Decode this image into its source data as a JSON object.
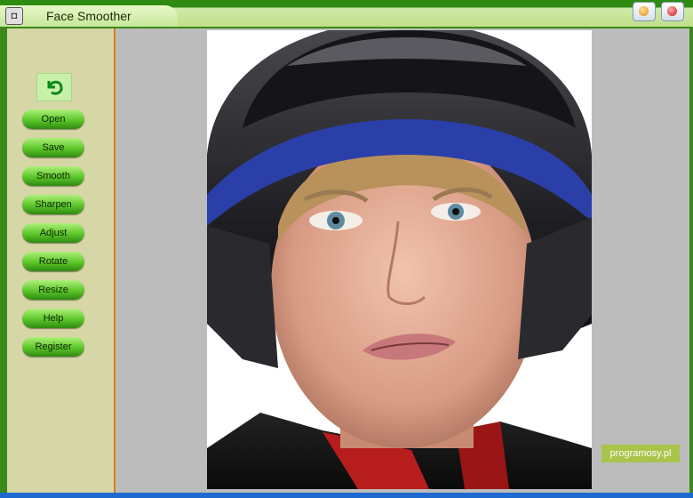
{
  "window": {
    "title": "Face Smoother",
    "controls": [
      "minimize",
      "close"
    ]
  },
  "sidebar": {
    "undo_icon": "undo-arrow-icon",
    "buttons": [
      {
        "label": "Open"
      },
      {
        "label": "Save"
      },
      {
        "label": "Smooth"
      },
      {
        "label": "Sharpen"
      },
      {
        "label": "Adjust"
      },
      {
        "label": "Rotate"
      },
      {
        "label": "Resize"
      },
      {
        "label": "Help"
      },
      {
        "label": "Register"
      }
    ]
  },
  "canvas": {
    "image": "portrait-photo",
    "watermark": "programosy.pl"
  },
  "colors": {
    "accent_green": "#5cc62a",
    "sidebar_bg": "#d6d6a6",
    "divider_orange": "#e07a1a"
  }
}
